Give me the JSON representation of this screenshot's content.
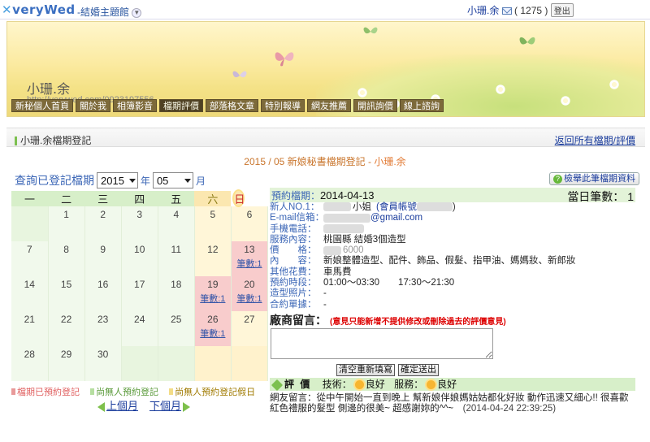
{
  "topbar": {
    "logo": "veryWed",
    "themes_label": "-結婚主題館",
    "user_name": "小珊.余",
    "mail_count": "( 1275 )",
    "logout": "登出"
  },
  "banner": {
    "name": "小珊.余",
    "url": "http://verywed.com/0923197556"
  },
  "nav": {
    "items": [
      "新秘個人首頁",
      "關於我",
      "相簿影音",
      "檔期評價",
      "部落格文章",
      "特別報導",
      "網友推薦",
      "開訊詢價",
      "線上諮詢"
    ],
    "active": "檔期評價"
  },
  "section": {
    "title": "小珊.余檔期登記",
    "back_link": "返回所有檔期/評價"
  },
  "calendar_heading": {
    "prefix": "2015 / 05 新娘秘書檔期登記 - ",
    "name": "小珊.余"
  },
  "query": {
    "label": "查詢已登記檔期",
    "year": "2015",
    "year_unit": "年",
    "month": "05",
    "month_unit": "月"
  },
  "calendar": {
    "weekdays": [
      "一",
      "二",
      "三",
      "四",
      "五",
      "六",
      "日"
    ],
    "weeks": [
      [
        {
          "d": ""
        },
        {
          "d": "1"
        },
        {
          "d": "2"
        },
        {
          "d": "3"
        },
        {
          "d": "4"
        },
        {
          "d": "5"
        },
        {
          "d": "6"
        }
      ],
      [
        {
          "d": "7"
        },
        {
          "d": "8"
        },
        {
          "d": "9"
        },
        {
          "d": "10"
        },
        {
          "d": "11"
        },
        {
          "d": "12"
        },
        {
          "d": "13",
          "count": "筆數:1"
        }
      ],
      [
        {
          "d": "14"
        },
        {
          "d": "15"
        },
        {
          "d": "16"
        },
        {
          "d": "17"
        },
        {
          "d": "18"
        },
        {
          "d": "19",
          "count": "筆數:1"
        },
        {
          "d": "20",
          "count": "筆數:1"
        }
      ],
      [
        {
          "d": "21"
        },
        {
          "d": "22"
        },
        {
          "d": "23"
        },
        {
          "d": "24"
        },
        {
          "d": "25"
        },
        {
          "d": "26",
          "count": "筆數:1"
        },
        {
          "d": "27"
        }
      ],
      [
        {
          "d": "28"
        },
        {
          "d": "29"
        },
        {
          "d": "30"
        },
        {
          "d": ""
        },
        {
          "d": ""
        },
        {
          "d": ""
        },
        {
          "d": ""
        }
      ]
    ]
  },
  "legend": {
    "booked": "檔期已預約登記",
    "free": "尚無人預約登記",
    "free_holiday": "尚無人預約登記假日"
  },
  "pager": {
    "prev": "上個月",
    "next": "下個月"
  },
  "report_button": "檢舉此筆檔期資料",
  "detail": {
    "date_label": "預約檔期：",
    "date": "2014-04-13",
    "day_count": "當日筆數： 1",
    "rows": [
      {
        "k": "新人NO.1：",
        "v": "小姐",
        "link": "(會員帳號",
        "end": ")"
      },
      {
        "k": "E-mail信箱：",
        "link": "@gmail.com"
      },
      {
        "k": "手機電話：",
        "v": ""
      },
      {
        "k": "服務內容：",
        "v": "桃園縣 結婚3個造型"
      },
      {
        "k": "價　　格：",
        "v": "6000"
      },
      {
        "k": "內　　容：",
        "v": "新娘整體造型、配件、飾品、假髮、指甲油、媽媽妝、新郎妝"
      },
      {
        "k": "其他花費：",
        "v": "車馬費"
      },
      {
        "k": "預約時段：",
        "v": "01:00～03:30　　17:30～21:30"
      },
      {
        "k": "造型照片：",
        "v": "-"
      },
      {
        "k": "合約單據：",
        "v": "-"
      }
    ],
    "msg_title": "廠商留言：",
    "msg_note": "(意見只能新增不提供修改或刪除過去的評價意見)",
    "clear_button": "清空重新填寫",
    "submit_button": "確定送出"
  },
  "review": {
    "title": "評 價",
    "tech_label": "技術：",
    "tech_value": "良好",
    "service_label": "服務：",
    "service_value": "良好",
    "text": "網友留言：從中午開始一直到晚上 幫新娘伴娘媽姑姑都化好妝 動作迅速又細心!! 很喜歡紅色禮服的髮型 側邊的很美~ 超感謝妳的^^~",
    "timestamp": "(2014-04-24 22:39:25)"
  },
  "colors": {
    "booked": "#f8cccc",
    "weekday_cell": "#f1f9ec",
    "weekend_cell": "#fff6d8",
    "link": "#1a3c9c",
    "nav_tab": "#7d6a3a"
  }
}
